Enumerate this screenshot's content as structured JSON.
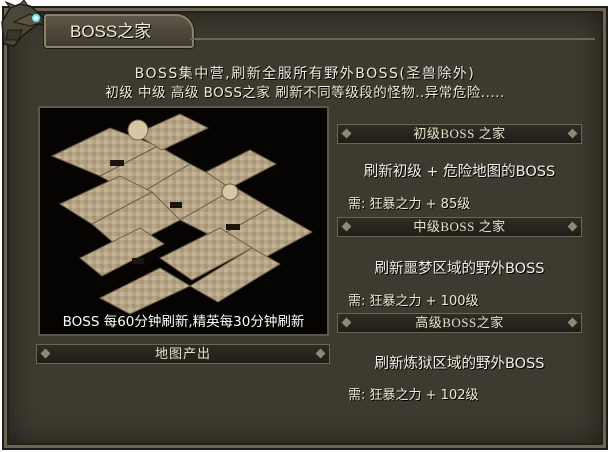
{
  "panel": {
    "title": "BOSS之家"
  },
  "intro": {
    "line1": "BOSS集中营,刷新全服所有野外BOSS(圣兽除外)",
    "line2": "初级  中级  高级 BOSS之家 刷新不同等级段的怪物..异常危险....."
  },
  "map": {
    "caption": "BOSS 每60分钟刷新,精英每30分钟刷新",
    "output_label": "地图产出"
  },
  "tiers": [
    {
      "header": "初级BOSS 之家",
      "description": "刷新初级 + 危险地图的BOSS",
      "requirement": "需: 狂暴之力 + 85级"
    },
    {
      "header": "中级BOSS 之家",
      "description": "刷新噩梦区域的野外BOSS",
      "requirement": "需: 狂暴之力 + 100级"
    },
    {
      "header": "高级BOSS之家",
      "description": "刷新炼狱区域的野外BOSS",
      "requirement": "需: 狂暴之力 + 102级"
    }
  ],
  "colors": {
    "panel_bg": "#3d3a2f",
    "border": "#6b6552",
    "text": "#f0ead8",
    "map_floor": "#b8a88a"
  },
  "icons": {
    "corner": "dragon-head-icon",
    "divider": "diamond-icon"
  }
}
